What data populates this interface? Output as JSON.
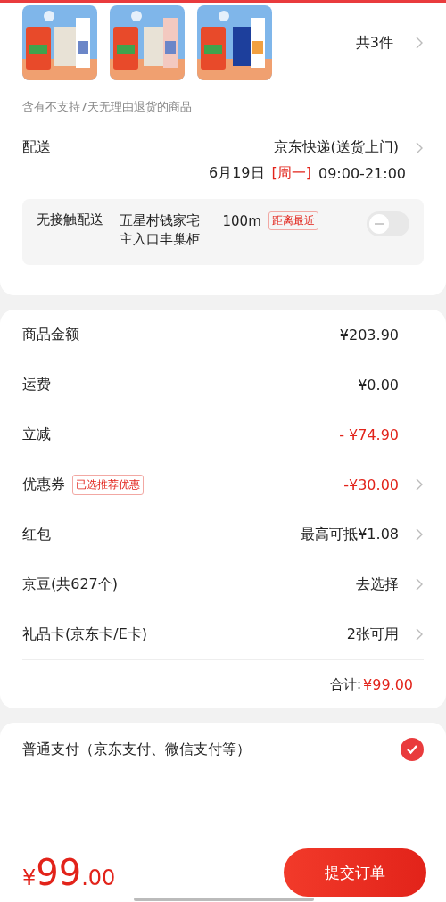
{
  "products": {
    "count": "共3件",
    "return_notice": "含有不支持7天无理由退货的商品"
  },
  "delivery": {
    "label": "配送",
    "method": "京东快递(送货上门)",
    "date": "6月19日",
    "weekday": "[周一]",
    "time": "09:00-21:00",
    "contactless": {
      "label": "无接触配送",
      "location": "五星村钱家宅主入口丰巢柜",
      "distance": "100m",
      "tag": "距离最近",
      "on": false
    }
  },
  "summary": {
    "rows": [
      {
        "label": "商品金额",
        "value": "¥203.90",
        "red": false,
        "arrow": false
      },
      {
        "label": "运费",
        "value": "¥0.00",
        "red": false,
        "arrow": false
      },
      {
        "label": "立减",
        "value": "- ¥74.90",
        "red": true,
        "arrow": false
      },
      {
        "label": "优惠券",
        "tag": "已选推荐优惠",
        "value": "-¥30.00",
        "red": true,
        "arrow": true
      },
      {
        "label": "红包",
        "value": "最高可抵¥1.08",
        "red": false,
        "arrow": true
      },
      {
        "label": "京豆(共627个)",
        "value": "去选择",
        "red": false,
        "arrow": true
      },
      {
        "label": "礼品卡(京东卡/E卡)",
        "value": "2张可用",
        "red": false,
        "arrow": true
      }
    ],
    "total_label": "合计:",
    "total": "¥99.00"
  },
  "payment": {
    "options": [
      {
        "label": "普通支付（京东支付、微信支付等）",
        "selected": true
      }
    ]
  },
  "bottom_bar": {
    "currency": "¥",
    "amount": "99",
    "decimals": ".00",
    "submit": "提交订单"
  }
}
